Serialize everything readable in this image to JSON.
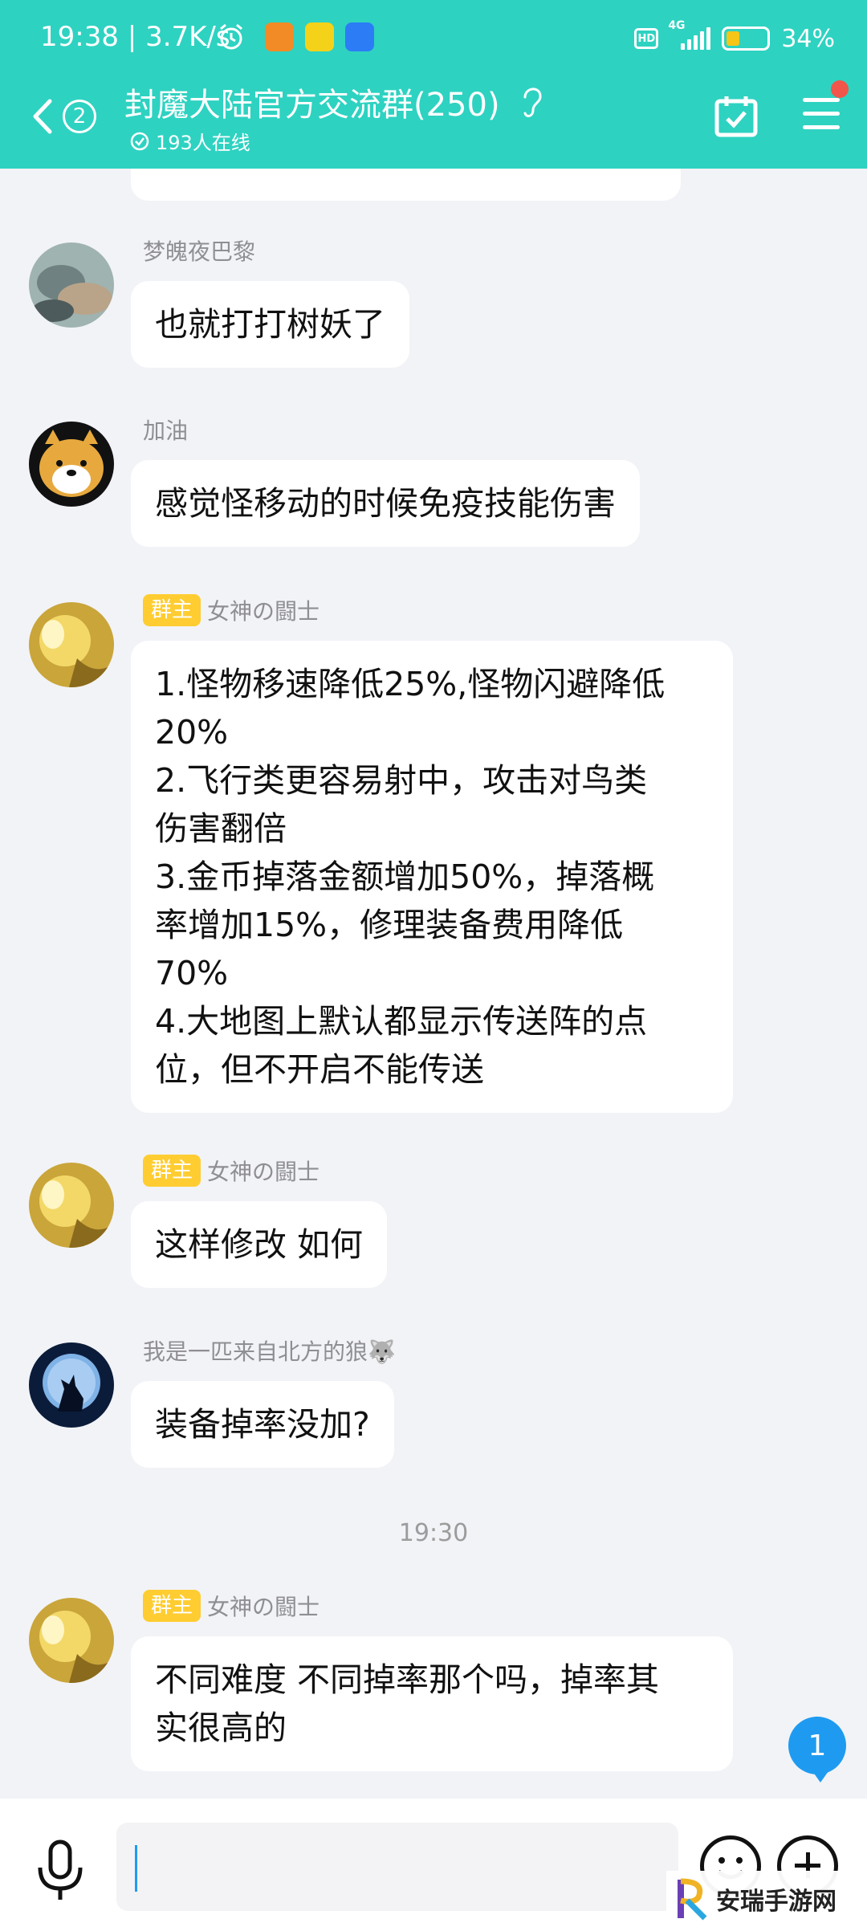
{
  "status_bar": {
    "time": "19:38",
    "speed": "3.7K/s",
    "network": "4G",
    "hd": "HD",
    "battery": "34%",
    "battery_level": 0.34
  },
  "header": {
    "unread_count": "2",
    "title": "封魔大陆官方交流群(250)",
    "online_text": "193人在线"
  },
  "owner_badge": "群主",
  "messages": [
    {
      "sender": "梦魄夜巴黎",
      "is_owner": false,
      "text": "也就打打树妖了",
      "avatar": "stone-figure-avatar"
    },
    {
      "sender": "加油",
      "is_owner": false,
      "text": "感觉怪移动的时候免疫技能伤害",
      "avatar": "shiba-dog-avatar"
    },
    {
      "sender": "女神の闘士",
      "is_owner": true,
      "text": "1.怪物移速降低25%,怪物闪避降低\n20%\n2.飞行类更容易射中，攻击对鸟类\n伤害翻倍\n3.金币掉落金额增加50%，掉落概\n率增加15%，修理装备费用降低\n70%\n4.大地图上默认都显示传送阵的点\n位，但不开启不能传送",
      "avatar": "golden-warrior-avatar"
    },
    {
      "sender": "女神の闘士",
      "is_owner": true,
      "text": "这样修改 如何",
      "avatar": "golden-warrior-avatar"
    },
    {
      "sender": "我是一匹来自北方的狼🐺",
      "is_owner": false,
      "text": "装备掉率没加?",
      "avatar": "wolf-moon-avatar"
    },
    {
      "sender": "女神の闘士",
      "is_owner": true,
      "text": "不同难度 不同掉率那个吗，掉率其\n实很高的",
      "avatar": "golden-warrior-avatar"
    }
  ],
  "time_separator": "19:30",
  "new_message_count": "1",
  "input": {
    "value": "",
    "placeholder": ""
  },
  "watermark": {
    "text": "安瑞手游网",
    "url": "www.szerg.com"
  },
  "colors": {
    "header_bg": "#2ed2c1",
    "owner_badge": "#ffcd32",
    "badge_blue": "#1e9bf0",
    "chat_bg": "#f2f3f7"
  }
}
